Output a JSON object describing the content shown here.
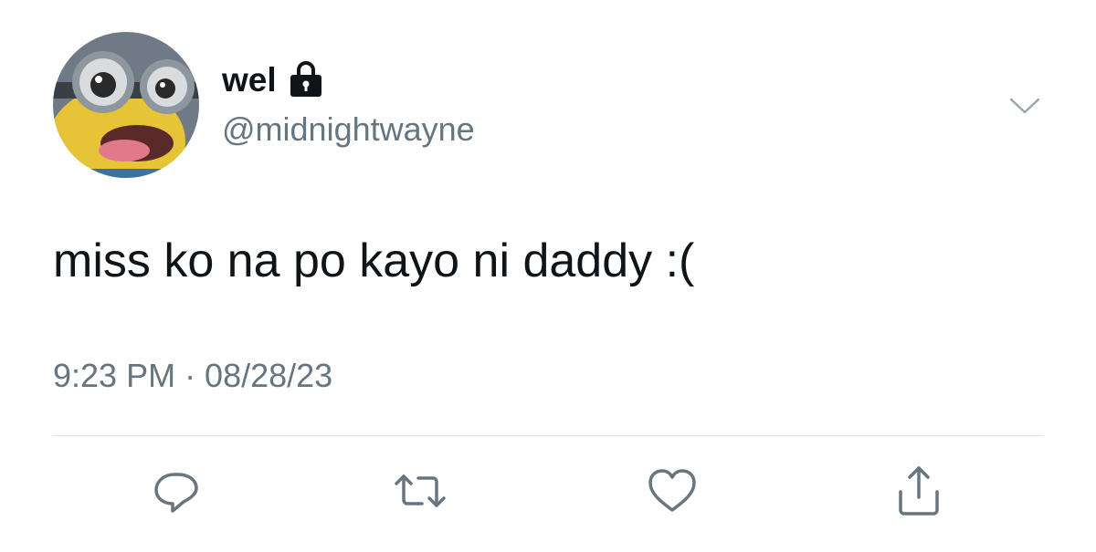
{
  "user": {
    "display_name": "wel",
    "handle": "@midnightwayne",
    "avatar_icon": "minion-avatar",
    "protected_icon": "lock-icon"
  },
  "tweet": {
    "text": "miss ko na po kayo ni daddy :(",
    "timestamp": "9:23 PM · 08/28/23"
  },
  "actions": [
    {
      "icon": "reply-icon"
    },
    {
      "icon": "retweet-icon"
    },
    {
      "icon": "like-icon"
    },
    {
      "icon": "share-icon"
    }
  ],
  "colors": {
    "text_primary": "#0f1419",
    "text_secondary": "#66757f",
    "icon": "#66757f",
    "divider": "#dfe3e6"
  }
}
